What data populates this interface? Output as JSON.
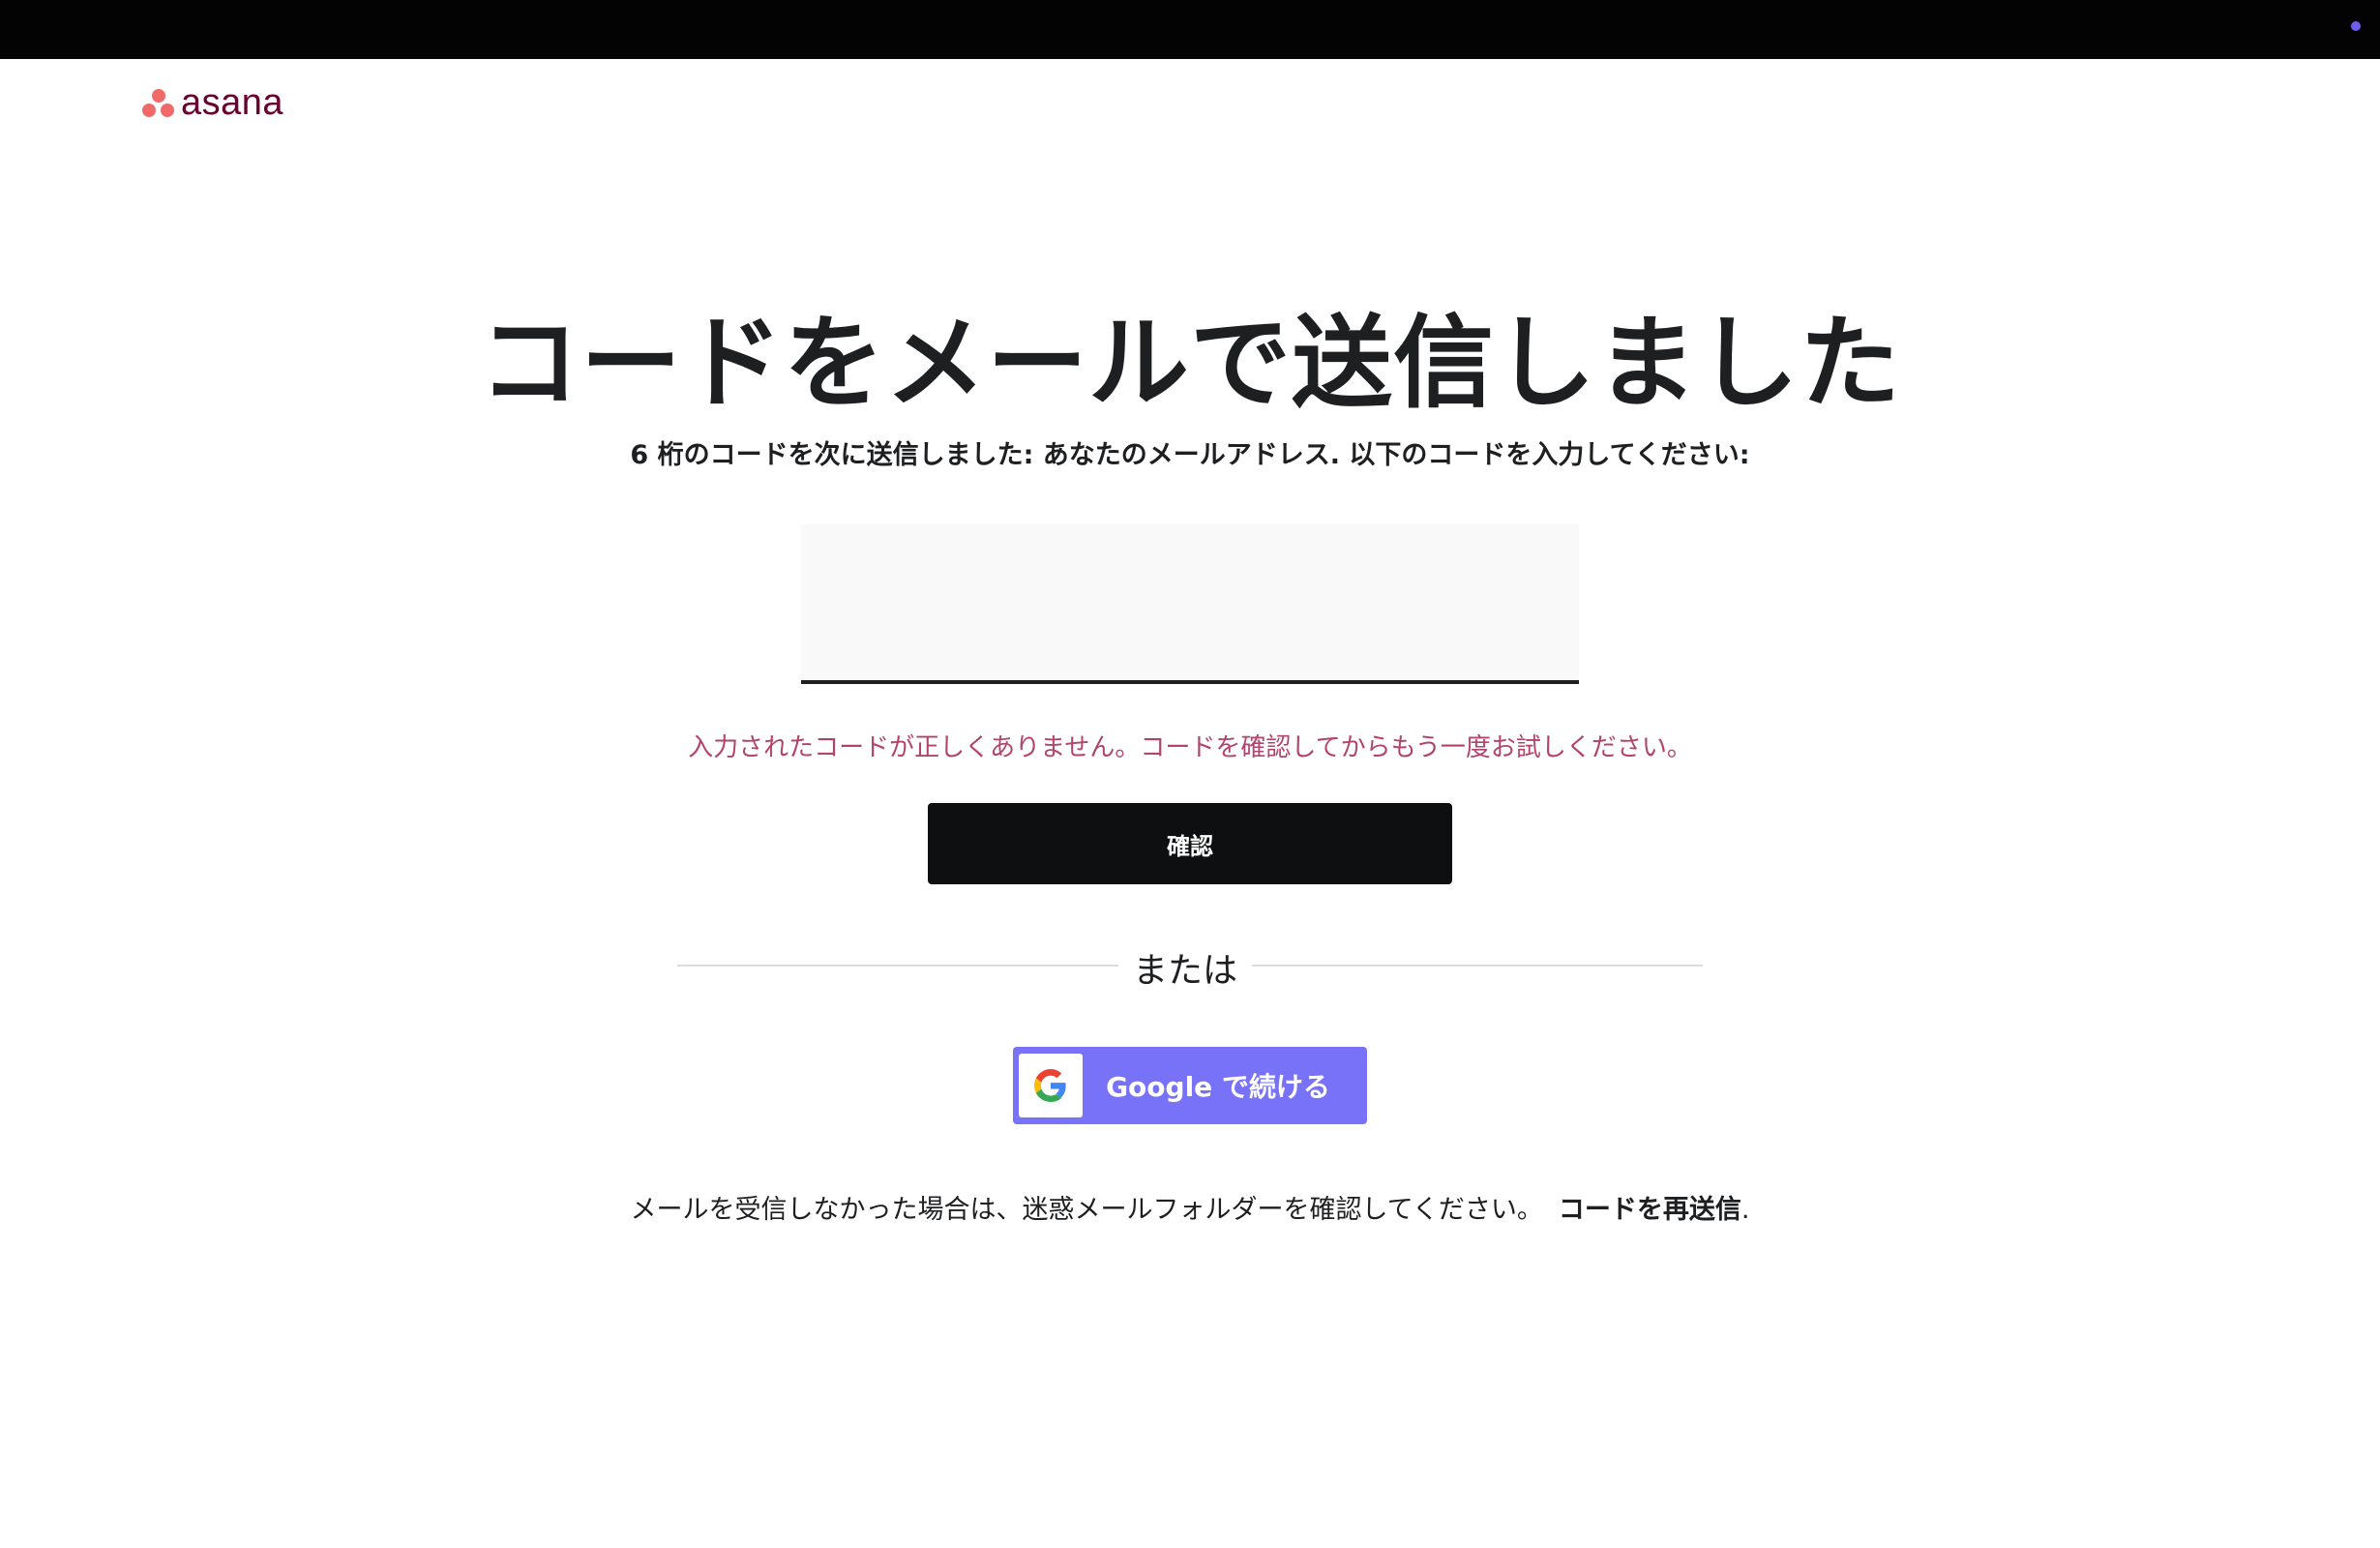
{
  "header": {
    "logo_text": "asana"
  },
  "main": {
    "heading": "コードをメールで送信しました",
    "subtext": "6 桁のコードを次に送信しました: あなたのメールアドレス. 以下のコードを入力してください:",
    "code_input": {
      "value": "",
      "placeholder": ""
    },
    "error_message": "入力されたコードが正しくありません。コードを確認してからもう一度お試しください。",
    "confirm_label": "確認",
    "divider_text": "または",
    "google_label": "Google で続ける",
    "footer_text": "メールを受信しなかった場合は、迷惑メールフォルダーを確認してください。",
    "resend_label": "コードを再送信",
    "resend_suffix": "."
  },
  "colors": {
    "topbar": "#030303",
    "brand_dots": "#f06a6a",
    "brand_text": "#690031",
    "error": "#b2446b",
    "confirm_button": "#0d0f10",
    "google_button": "#7872f8",
    "topbar_indicator": "#6d5cf0"
  },
  "icons": {
    "logo": "asana-logo-icon",
    "google": "google-g-icon"
  }
}
